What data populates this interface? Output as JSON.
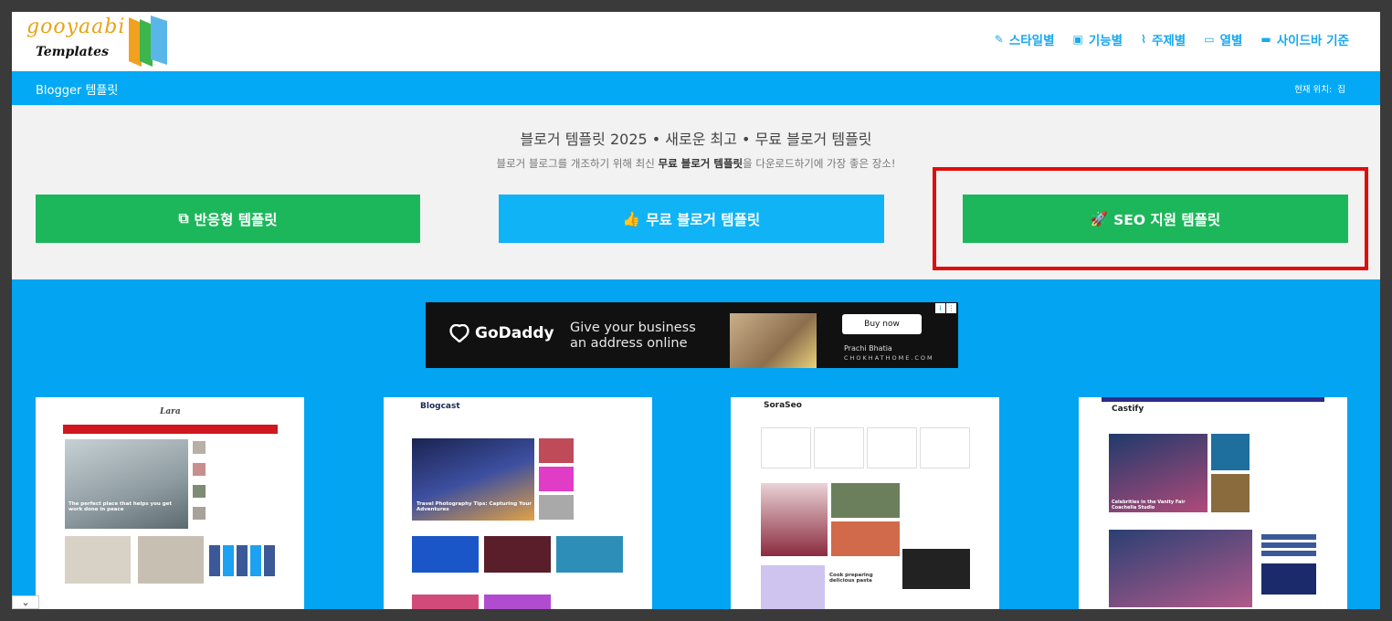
{
  "header": {
    "logo_line1": "gooyaabi",
    "logo_line2": "Templates",
    "nav": [
      {
        "label": "스타일별",
        "icon": "brush-icon",
        "glyph": "✎"
      },
      {
        "label": "기능별",
        "icon": "briefcase-icon",
        "glyph": "▣"
      },
      {
        "label": "주제별",
        "icon": "paperclip-icon",
        "glyph": "⌇"
      },
      {
        "label": "열별",
        "icon": "window-icon",
        "glyph": "▭"
      },
      {
        "label": "사이드바 기준",
        "icon": "card-icon",
        "glyph": "▬"
      }
    ]
  },
  "breadcrumb": {
    "title": "Blogger 템플릿",
    "location_label": "현재 위치:",
    "location_value": "집"
  },
  "hero": {
    "title": "블로거 템플릿 2025 • 새로운 최고 • 무료 블로거 템플릿",
    "subtitle_pre": "블로거 블로그를 개조하기 위해 최신 ",
    "subtitle_bold": "무료 블로거 템플릿",
    "subtitle_post": "을 다운로드하기에 가장 좋은 장소!",
    "buttons": [
      {
        "label": "반응형 템플릿",
        "icon": "responsive-icon",
        "glyph": "⧉",
        "color": "#1db75b"
      },
      {
        "label": "무료 블로거 템플릿",
        "icon": "thumbs-up-icon",
        "glyph": "👍",
        "color": "#10b4f6"
      },
      {
        "label": "SEO 지원 템플릿",
        "icon": "rocket-icon",
        "glyph": "🚀",
        "color": "#1db75b"
      }
    ]
  },
  "ad": {
    "brand": "GoDaddy",
    "copy_line1": "Give your business",
    "copy_line2": "an address online",
    "cta": "Buy now",
    "person": "Prachi Bhatia",
    "site": "CHOKHATHOME.COM"
  },
  "templates": [
    {
      "name": "Lara",
      "headline": "The perfect place that helps you get work done in peace",
      "accent": "#d0171f"
    },
    {
      "name": "Blogcast",
      "headline": "Travel Photography Tips: Capturing Your Adventures",
      "accent": "#1b2a55"
    },
    {
      "name": "SoraSeo",
      "headline": "Cook preparing delicious pasta",
      "accent": "#3a7bd5"
    },
    {
      "name": "Castify",
      "headline": "Celebrities in the Vanity Fair Coachella Studio",
      "accent": "#e0204a"
    }
  ],
  "colors": {
    "accent_blue": "#03a9f4",
    "green": "#1db75b",
    "highlight_red": "#e00d0d"
  }
}
